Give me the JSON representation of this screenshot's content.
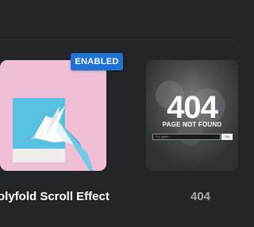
{
  "cards": [
    {
      "badge": "ENABLED",
      "title": "olyfold Scroll Effect",
      "badge_color": "#1f73d8",
      "thumb_bg": "#efbfd6",
      "icon": "origami-bird-icon"
    },
    {
      "title": "404",
      "thumb_bg": "#38393c",
      "thumb": {
        "code": "404",
        "subtitle": "PAGE NOT FOUND",
        "search_placeholder": "Try again...",
        "search_button": "Go"
      }
    }
  ],
  "colors": {
    "page_bg": "#232428",
    "title_active": "#ffffff",
    "title_muted": "#a7a8ad"
  }
}
